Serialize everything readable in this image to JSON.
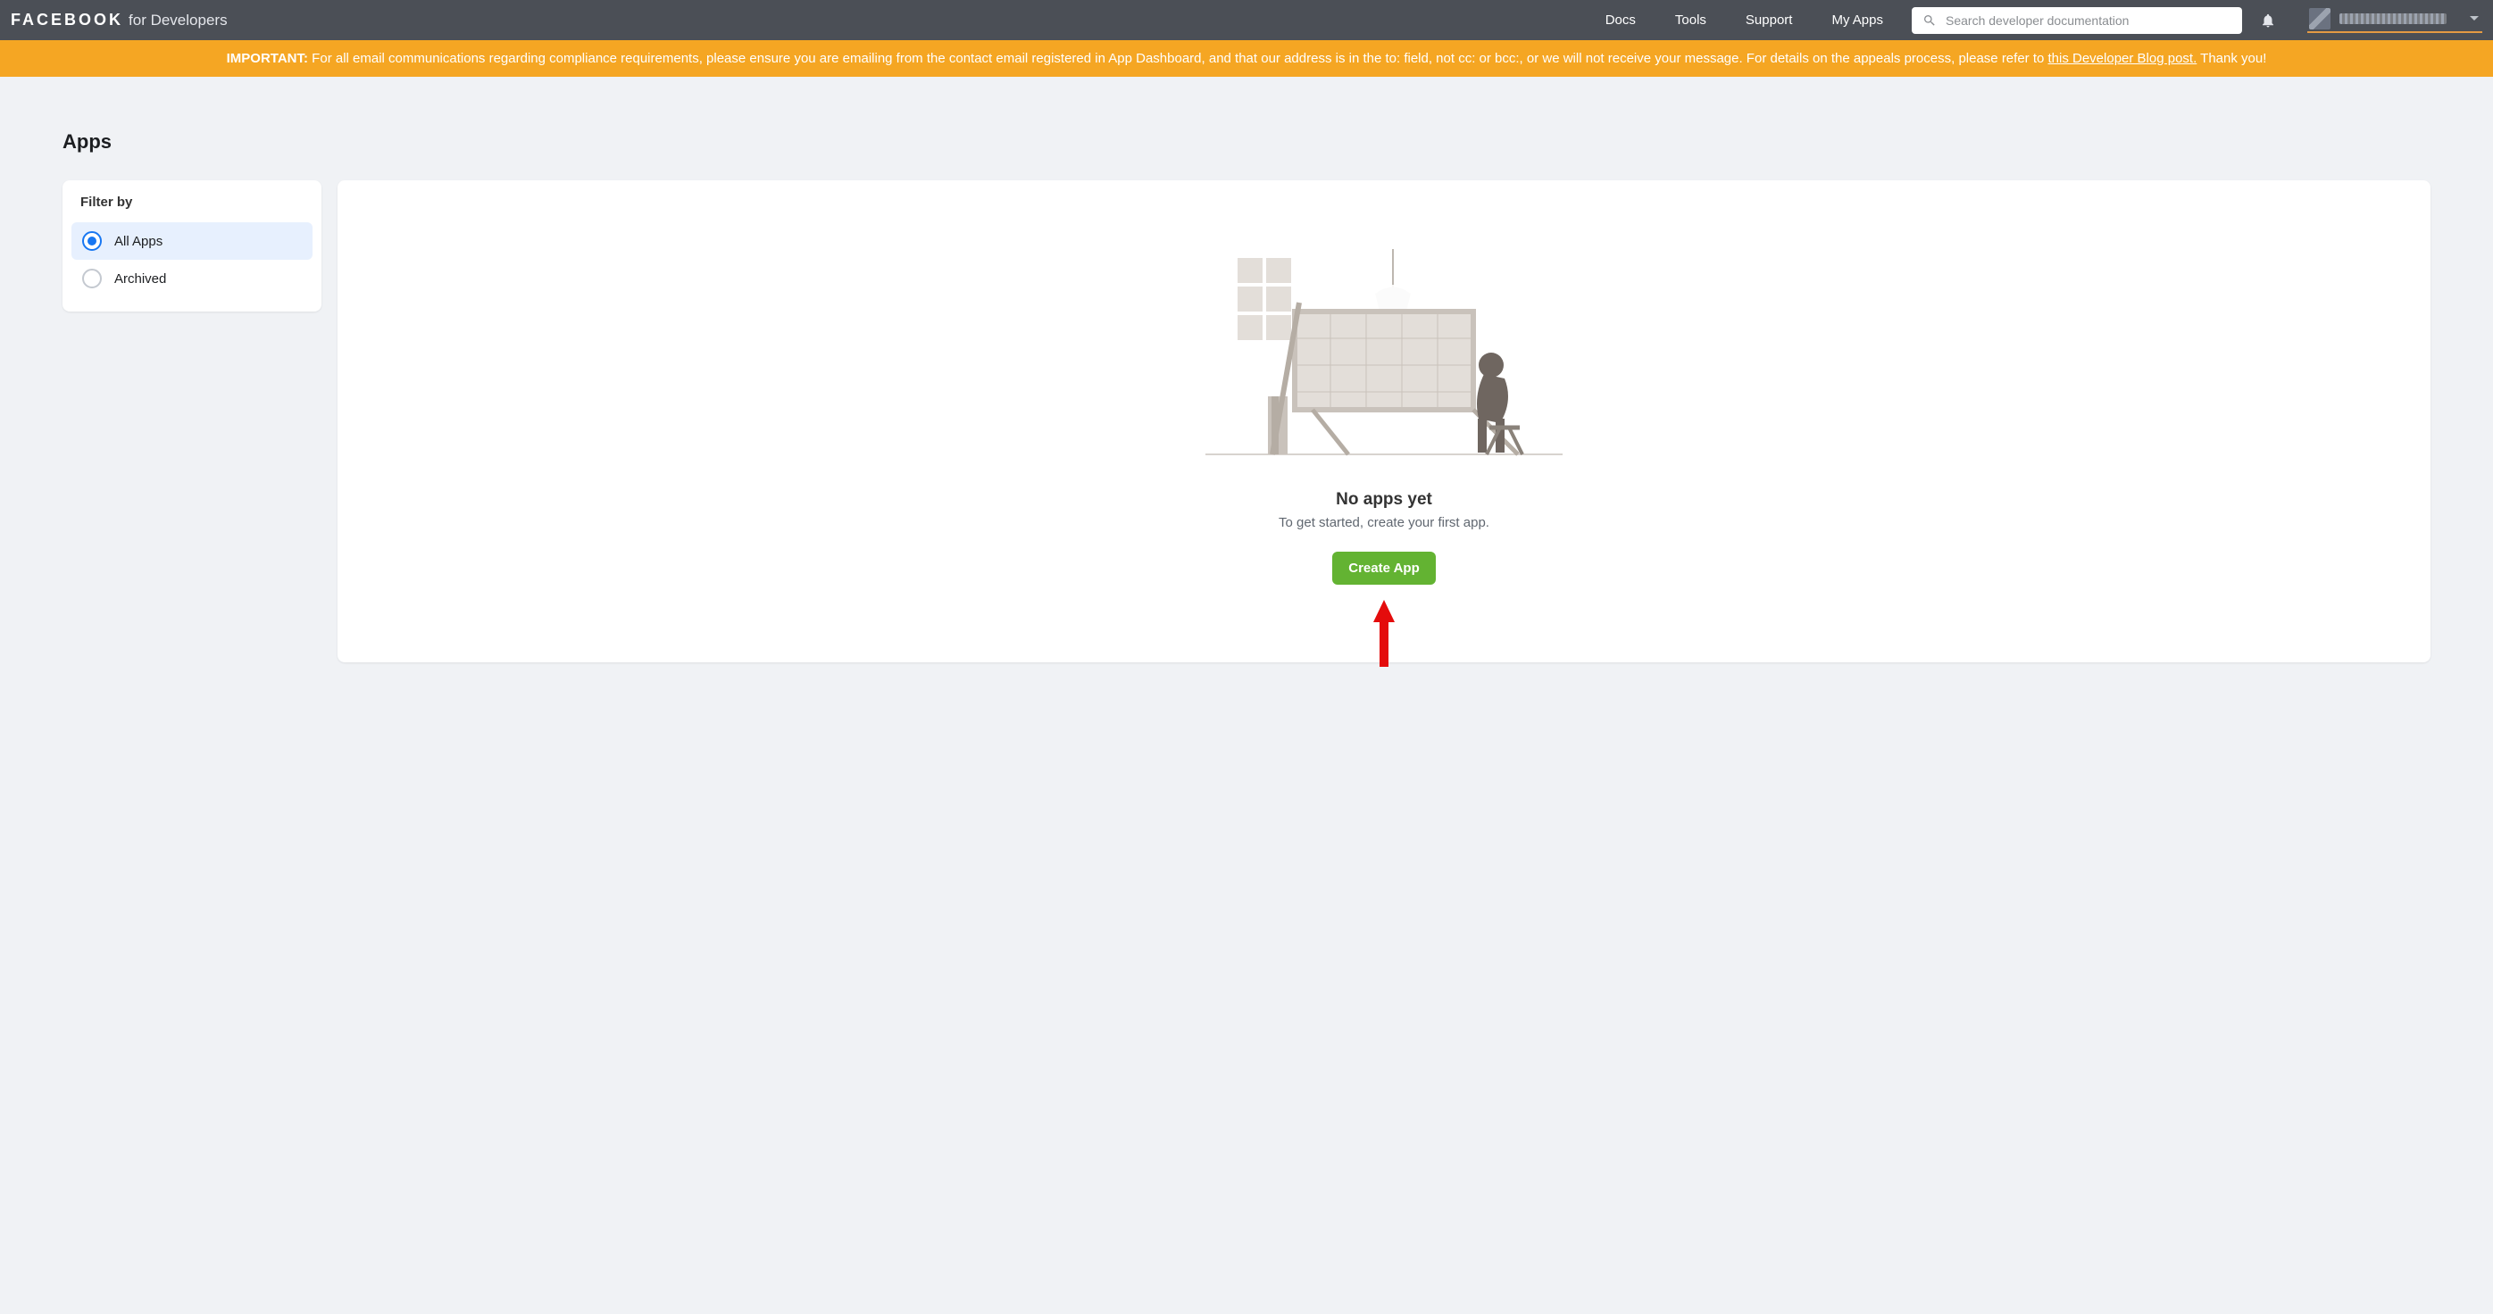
{
  "header": {
    "brand_main": "FACEBOOK",
    "brand_sub": "for Developers",
    "nav": {
      "docs": "Docs",
      "tools": "Tools",
      "support": "Support",
      "myapps": "My Apps"
    },
    "search_placeholder": "Search developer documentation"
  },
  "banner": {
    "strong": "IMPORTANT:",
    "text_before_link": " For all email communications regarding compliance requirements, please ensure you are emailing from the contact email registered in App Dashboard, and that our address is in the to: field, not cc: or bcc:, or we will not receive your message. For details on the appeals process, please refer to ",
    "link_text": "this Developer Blog post.",
    "text_after_link": " Thank you!"
  },
  "page": {
    "title": "Apps"
  },
  "filter": {
    "title": "Filter by",
    "options": [
      {
        "label": "All Apps",
        "selected": true
      },
      {
        "label": "Archived",
        "selected": false
      }
    ]
  },
  "empty_state": {
    "title": "No apps yet",
    "subtitle": "To get started, create your first app.",
    "cta": "Create App"
  }
}
